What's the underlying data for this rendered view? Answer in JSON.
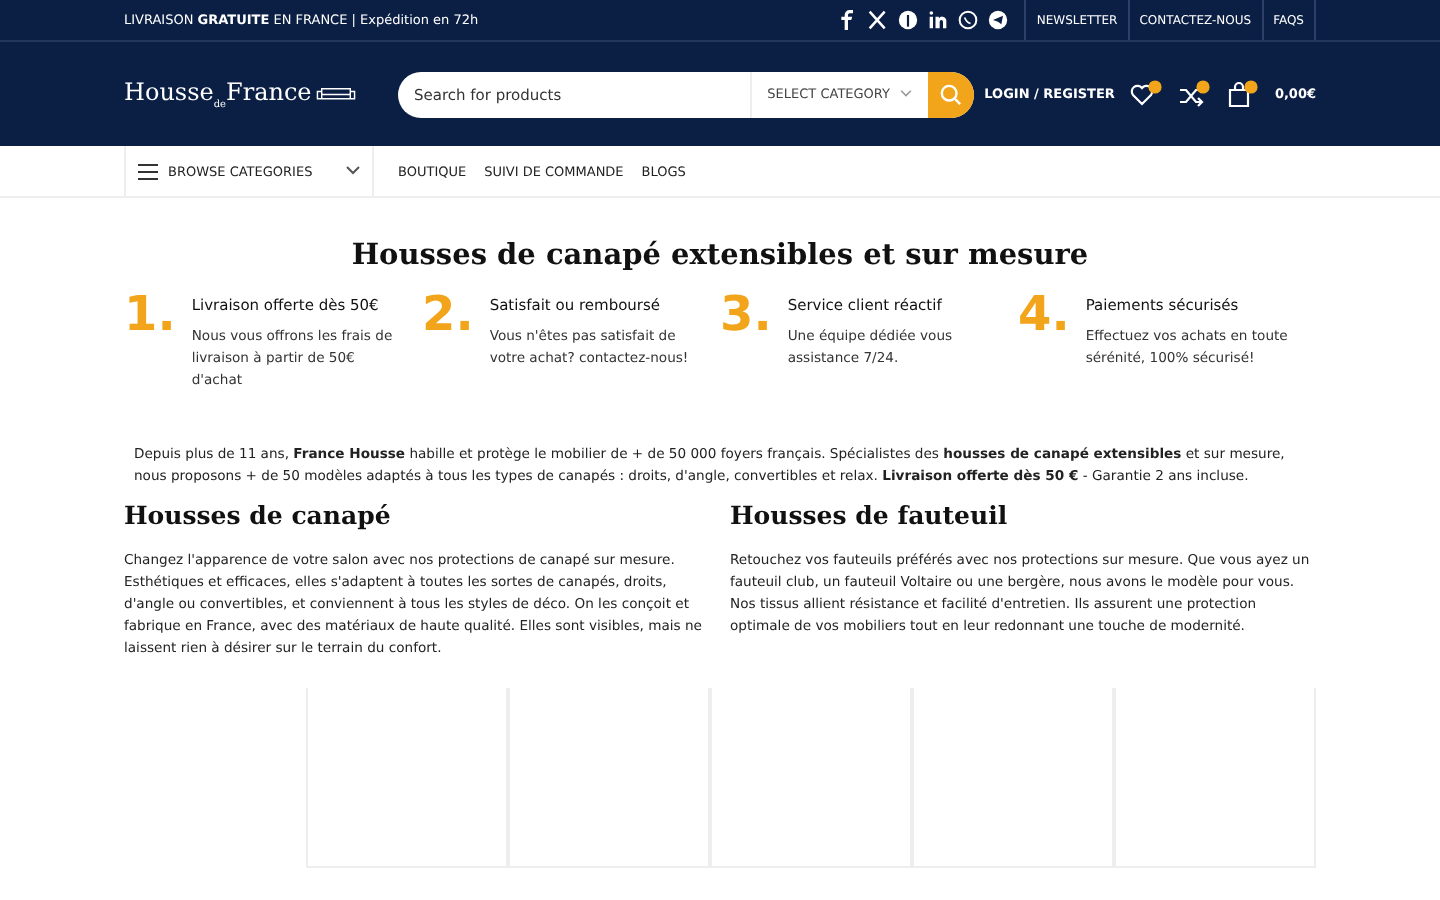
{
  "topbar": {
    "promo": "LIVRAISON **GRATUITE** EN FRANCE | Expédition en 72h",
    "links": [
      "NEWSLETTER",
      "CONTACTEZ-NOUS",
      "FAQS"
    ]
  },
  "header": {
    "logo": "Housse$_{de}$France",
    "search": {
      "placeholder": "Search for products",
      "category": "SELECT CATEGORY"
    },
    "login": "LOGIN / REGISTER",
    "cart_total": "0,00€"
  },
  "nav": {
    "browse": "BROWSE CATEGORIES",
    "items": [
      "BOUTIQUE",
      "SUIVI DE COMMANDE",
      "BLOGS"
    ]
  },
  "title": "Housses de canapé extensibles et sur mesure",
  "features": [
    {
      "number": "1.",
      "title": "Livraison offerte dès 50€",
      "text": "Nous vous offrons les frais de livraison à partir de 50€ d'achat"
    },
    {
      "number": "2.",
      "title": "Satisfait ou remboursé",
      "text": "Vous n'êtes pas satisfait de votre achat? contactez-nous!"
    },
    {
      "number": "3.",
      "title": "Service client réactif",
      "text": "Une équipe dédiée vous assistance 7/24."
    },
    {
      "number": "4.",
      "title": "Paiements sécurisés",
      "text": "Effectuez vos achats en toute sérénité, 100% sécurisé!"
    }
  ],
  "intro": "Depuis plus de 11 ans, **France Housse** habille et protège le mobilier de + de 50 000 foyers français. Spécialistes des **housses de canapé extensibles** et sur mesure, nous proposons + de 50 modèles adaptés à tous les types de canapés : droits, d'angle, convertibles et relax. **Livraison offerte dès 50 €** - Garantie 2 ans incluse.",
  "sections": [
    {
      "heading": "Housses de canapé",
      "text": "Changez l'apparence de votre salon avec nos protections de canapé sur mesure. Esthétiques et efficaces, elles s'adaptent à toutes les sortes de canapés, droits, d'angle ou convertibles, et conviennent à tous les styles de déco. On les conçoit et fabrique en France, avec des matériaux de haute qualité. Elles sont visibles, mais ne laissent rien à désirer sur le terrain du confort."
    },
    {
      "heading": "Housses de fauteuil",
      "text": "Retouchez vos fauteuils préférés avec nos protections sur mesure. Que vous ayez un fauteuil club, un fauteuil Voltaire ou une bergère, nous avons le modèle pour vous. Nos tissus allient résistance et facilité d'entretien. Ils assurent une protection optimale de vos mobiliers tout en leur redonnant une touche de modernité."
    }
  ]
}
